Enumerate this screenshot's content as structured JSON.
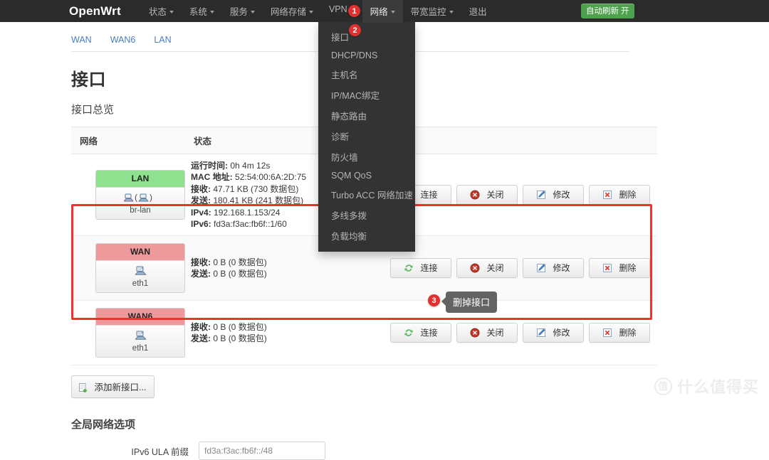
{
  "nav": {
    "brand": "OpenWrt",
    "items": [
      {
        "label": "状态",
        "caret": true,
        "active": false
      },
      {
        "label": "系统",
        "caret": true,
        "active": false
      },
      {
        "label": "服务",
        "caret": true,
        "active": false
      },
      {
        "label": "网络存储",
        "caret": true,
        "active": false
      },
      {
        "label": "VPN",
        "caret": true,
        "active": false
      },
      {
        "label": "网络",
        "caret": true,
        "active": true
      },
      {
        "label": "带宽监控",
        "caret": true,
        "active": false
      },
      {
        "label": "退出",
        "caret": false,
        "active": false
      }
    ],
    "auto_refresh_label": "自动刷新",
    "auto_refresh_state": "开"
  },
  "dropdown": {
    "items": [
      "接口",
      "DHCP/DNS",
      "主机名",
      "IP/MAC绑定",
      "静态路由",
      "诊断",
      "防火墙",
      "SQM QoS",
      "Turbo ACC 网络加速",
      "多线多拨",
      "负载均衡"
    ]
  },
  "badges": [
    {
      "id": "badge1",
      "number": "1"
    },
    {
      "id": "badge2",
      "number": "2"
    },
    {
      "id": "badge3",
      "number": "3"
    }
  ],
  "tabs": [
    "WAN",
    "WAN6",
    "LAN"
  ],
  "page": {
    "title": "接口",
    "section_title": "接口总览",
    "global_title": "全局网络选项"
  },
  "table": {
    "headers": [
      "网络",
      "状态"
    ],
    "rows": [
      {
        "name": "LAN",
        "device": "br-lan",
        "state": "up",
        "stats": [
          {
            "key": "运行时间:",
            "value": "0h 4m 12s"
          },
          {
            "key": "MAC 地址:",
            "value": "52:54:00:6A:2D:75"
          },
          {
            "key": "接收:",
            "value": "47.71 KB (730 数据包)"
          },
          {
            "key": "发送:",
            "value": "180.41 KB (241 数据包)"
          },
          {
            "key": "IPv4:",
            "value": "192.168.1.153/24"
          },
          {
            "key": "IPv6:",
            "value": "fd3a:f3ac:fb6f::1/60"
          }
        ]
      },
      {
        "name": "WAN",
        "device": "eth1",
        "state": "down",
        "stats": [
          {
            "key": "接收:",
            "value": "0 B (0 数据包)"
          },
          {
            "key": "发送:",
            "value": "0 B (0 数据包)"
          }
        ]
      },
      {
        "name": "WAN6",
        "device": "eth1",
        "state": "down",
        "stats": [
          {
            "key": "接收:",
            "value": "0 B (0 数据包)"
          },
          {
            "key": "发送:",
            "value": "0 B (0 数据包)"
          }
        ]
      }
    ],
    "actions": [
      {
        "label": "连接",
        "icon": "refresh-icon"
      },
      {
        "label": "关闭",
        "icon": "stop-icon"
      },
      {
        "label": "修改",
        "icon": "edit-icon"
      },
      {
        "label": "删除",
        "icon": "delete-icon"
      }
    ]
  },
  "add_button": {
    "label": "添加新接口...",
    "icon": "add-page-icon"
  },
  "tooltip": {
    "text": "删掉接口"
  },
  "ula": {
    "label": "IPv6 ULA 前缀",
    "value": "fd3a:f3ac:fb6f::/48"
  },
  "watermark": {
    "mark": "值",
    "text": "什么值得买"
  },
  "colors": {
    "navbar": "#2b2b2b",
    "dropdown": "#333333",
    "badge": "#e03030",
    "highlight": "#f23030",
    "up": "#8fe08f",
    "down": "#ef9a9a",
    "accent_green": "#4ea24e",
    "link": "#4a7ebb",
    "tooltip": "#636363"
  }
}
